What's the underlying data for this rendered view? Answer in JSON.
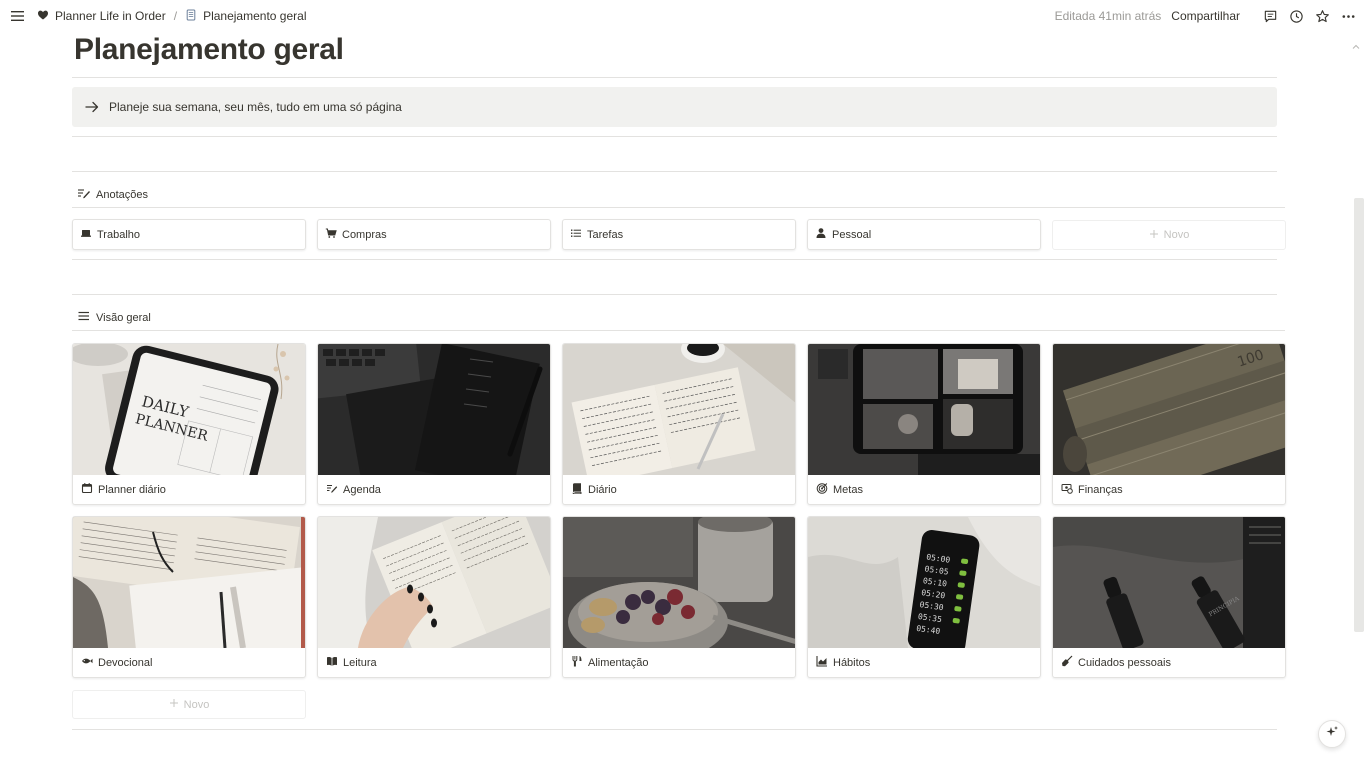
{
  "topbar": {
    "menu_icon": "hamburger-icon",
    "breadcrumb": [
      {
        "icon": "heart-icon",
        "label": "Planner Life in Order"
      },
      {
        "icon": "page-icon",
        "label": "Planejamento geral"
      }
    ],
    "separator": "/",
    "edited": "Editada 41min atrás",
    "share": "Compartilhar",
    "icons": [
      "comment-icon",
      "clock-icon",
      "star-icon",
      "more-icon"
    ]
  },
  "page": {
    "title": "Planejamento geral",
    "callout": {
      "icon": "arrow-right-icon",
      "text": "Planeje sua semana, seu mês, tudo em uma só página"
    }
  },
  "notes_section": {
    "heading": "Anotações",
    "icon": "pencil-lines-icon",
    "cards": [
      {
        "label": "Trabalho",
        "icon": "laptop-icon"
      },
      {
        "label": "Compras",
        "icon": "cart-icon"
      },
      {
        "label": "Tarefas",
        "icon": "list-icon"
      },
      {
        "label": "Pessoal",
        "icon": "person-icon"
      }
    ],
    "new_label": "Novo"
  },
  "overview_section": {
    "heading": "Visão geral",
    "icon": "lines-icon",
    "cards": [
      {
        "label": "Planner diário",
        "icon": "calendar-icon"
      },
      {
        "label": "Agenda",
        "icon": "pencil-lines-icon"
      },
      {
        "label": "Diário",
        "icon": "book-icon"
      },
      {
        "label": "Metas",
        "icon": "target-icon"
      },
      {
        "label": "Finanças",
        "icon": "money-icon"
      },
      {
        "label": "Devocional",
        "icon": "fish-icon"
      },
      {
        "label": "Leitura",
        "icon": "open-book-icon"
      },
      {
        "label": "Alimentação",
        "icon": "utensils-icon"
      },
      {
        "label": "Hábitos",
        "icon": "chart-icon"
      },
      {
        "label": "Cuidados pessoais",
        "icon": "broom-icon"
      }
    ],
    "new_label": "Novo"
  },
  "fab_icon": "sparkle-icon"
}
